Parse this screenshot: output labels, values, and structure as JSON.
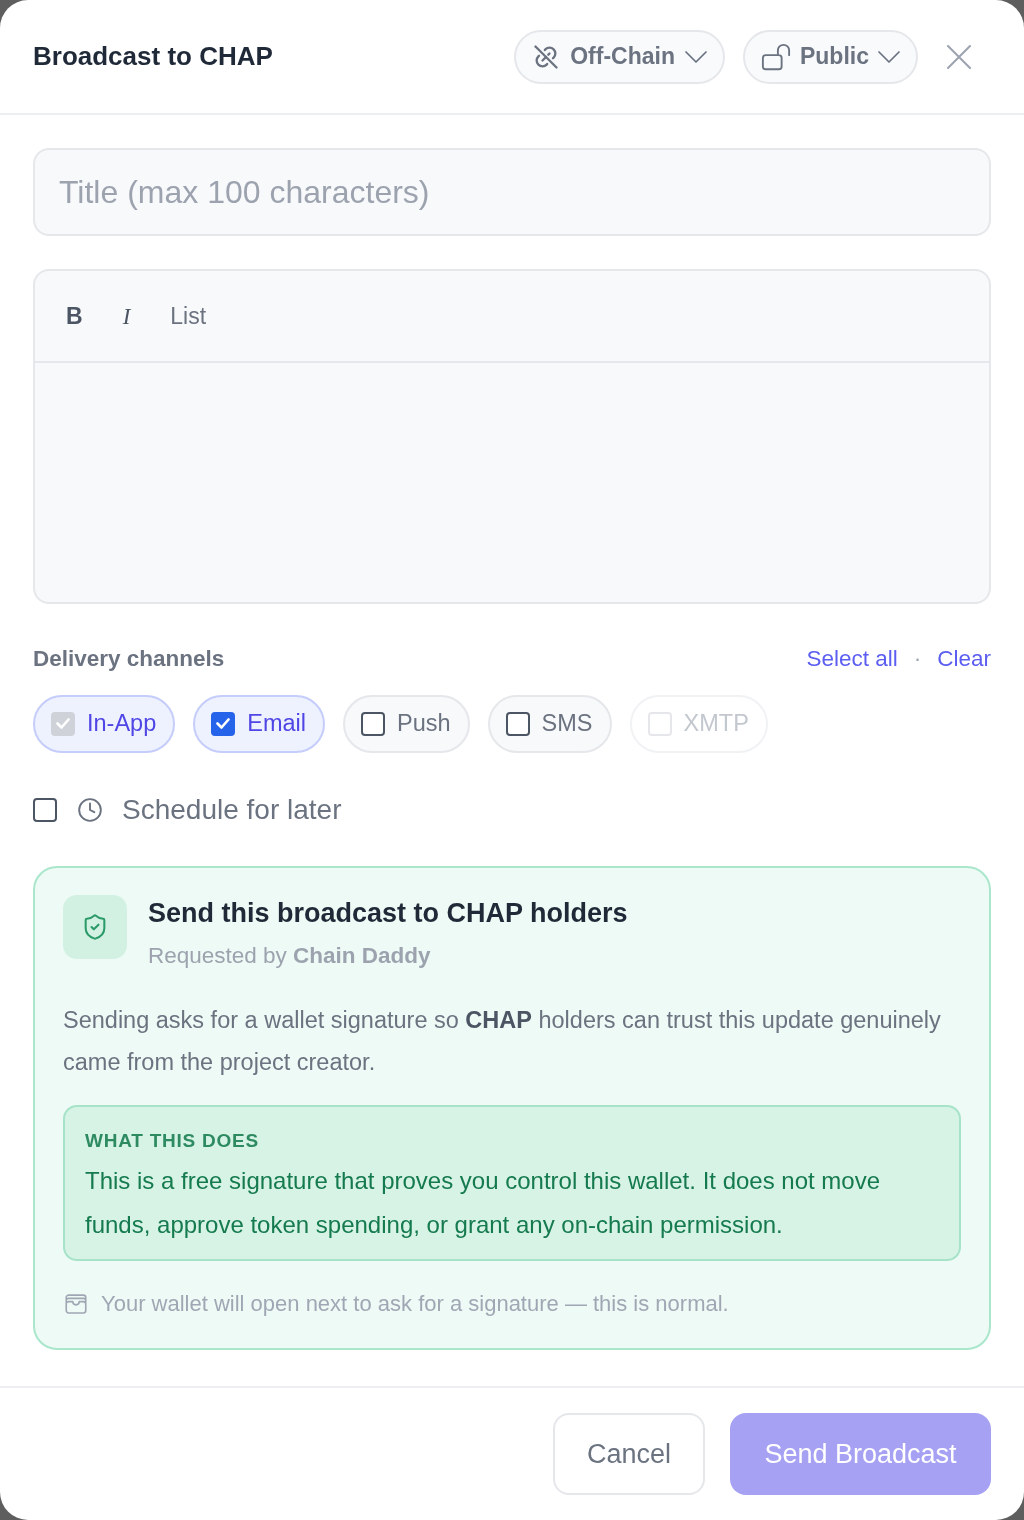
{
  "dialog": {
    "title": "Broadcast to CHAP",
    "network_menu": {
      "label": "Off-Chain"
    },
    "visibility_menu": {
      "label": "Public"
    }
  },
  "title_field": {
    "placeholder": "Title (max 100 characters)"
  },
  "editor": {
    "toolbar": [
      {
        "kind": "bold",
        "label": "B"
      },
      {
        "kind": "italic",
        "label": "I"
      },
      {
        "kind": "list",
        "label": "List"
      }
    ]
  },
  "delivery": {
    "label": "Delivery channels",
    "select_all_link": "Select all",
    "separator": "·",
    "clear_link": "Clear",
    "channels": [
      {
        "label": "In-App",
        "checked": true,
        "disabled": true
      },
      {
        "label": "Email",
        "checked": true,
        "disabled": false
      },
      {
        "label": "Push",
        "checked": false,
        "disabled": false
      },
      {
        "label": "SMS",
        "checked": false,
        "disabled": false
      },
      {
        "label": "XMTP",
        "checked": false,
        "disabled": true
      }
    ]
  },
  "schedule": {
    "label": "Schedule for later",
    "checked": false
  },
  "signature_card": {
    "title": "Send this broadcast to CHAP holders",
    "requested_by": "Requested by **Chain Daddy**",
    "description": "Sending asks for a wallet signature so **CHAP** holders can trust this update genuinely came from the project creator.",
    "info": {
      "heading": "WHAT THIS DOES",
      "text": "This is a free signature that proves you control this wallet. It does not move funds, approve token spending, or grant any on-chain permission."
    },
    "note": "Your wallet will open next to ask for a signature — this is normal."
  },
  "footer": {
    "buttons": [
      {
        "kind": "secondary",
        "label": "Cancel",
        "disabled": false
      },
      {
        "kind": "primary",
        "label": "Send Broadcast",
        "disabled": true
      }
    ]
  }
}
